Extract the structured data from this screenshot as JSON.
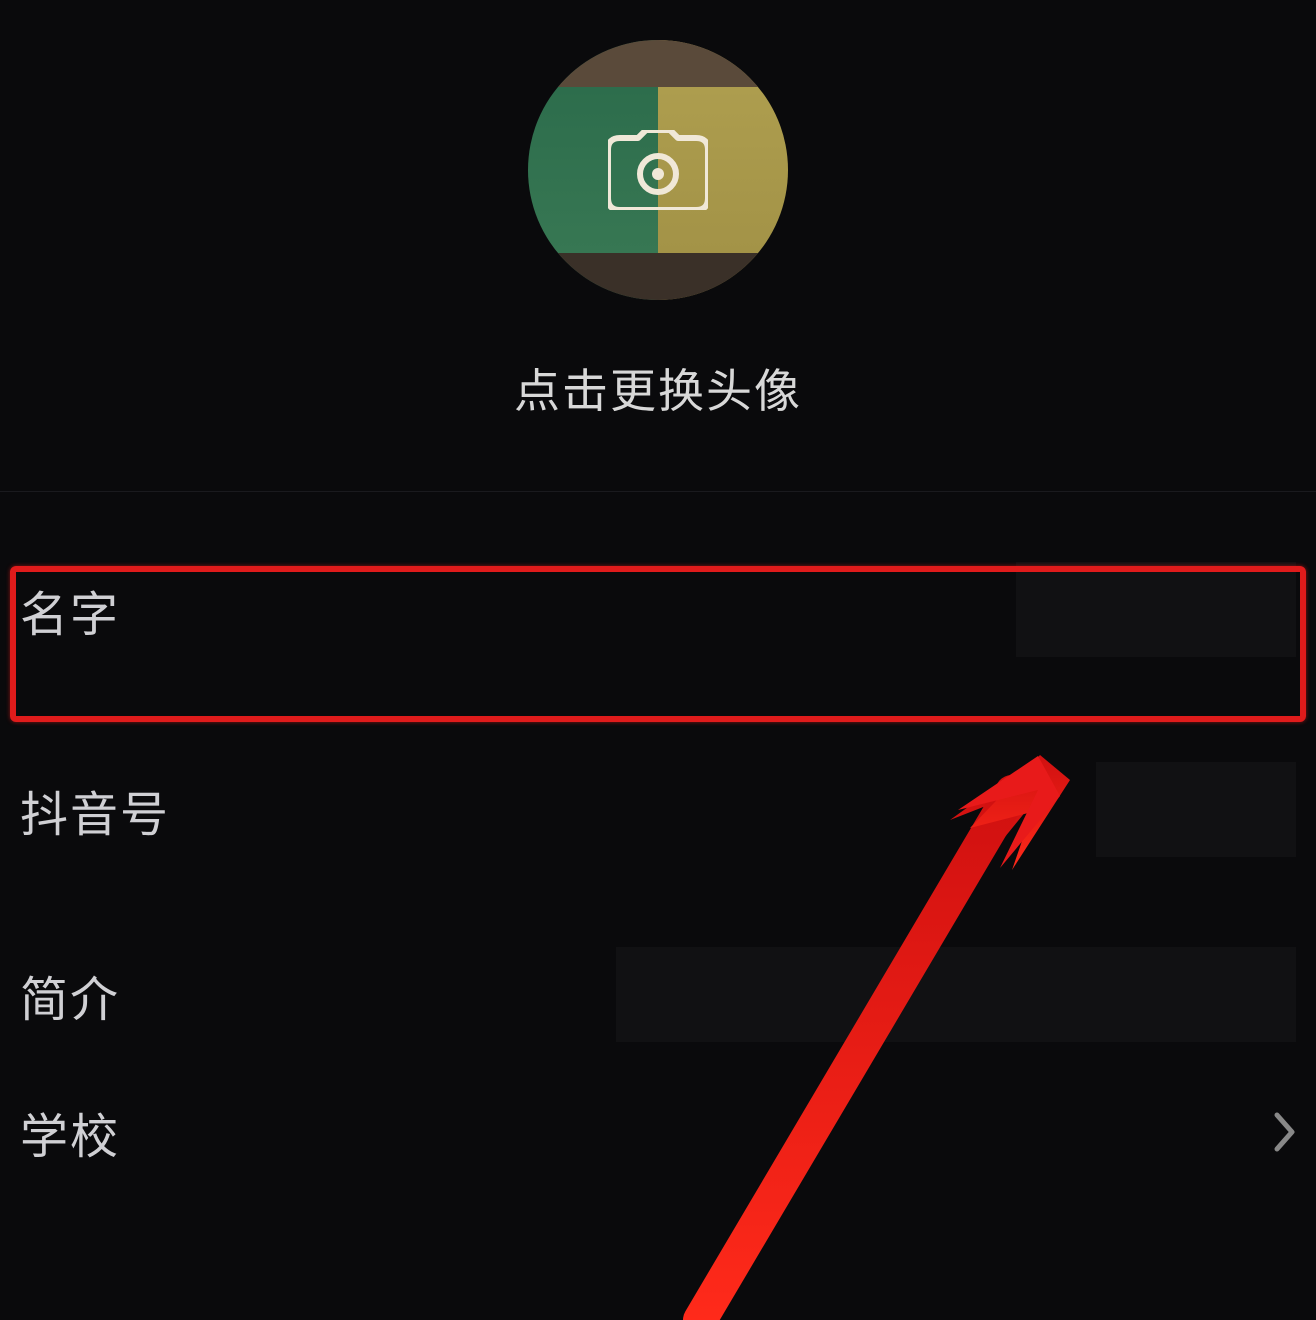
{
  "avatar": {
    "hint": "点击更换头像",
    "icon_name": "camera-icon"
  },
  "rows": {
    "name": {
      "label": "名字"
    },
    "douyin_id": {
      "label": "抖音号"
    },
    "intro": {
      "label": "简介"
    },
    "school": {
      "label": "学校"
    }
  },
  "annotation": {
    "highlight_target": "name-row",
    "color": "#e01b1b"
  }
}
